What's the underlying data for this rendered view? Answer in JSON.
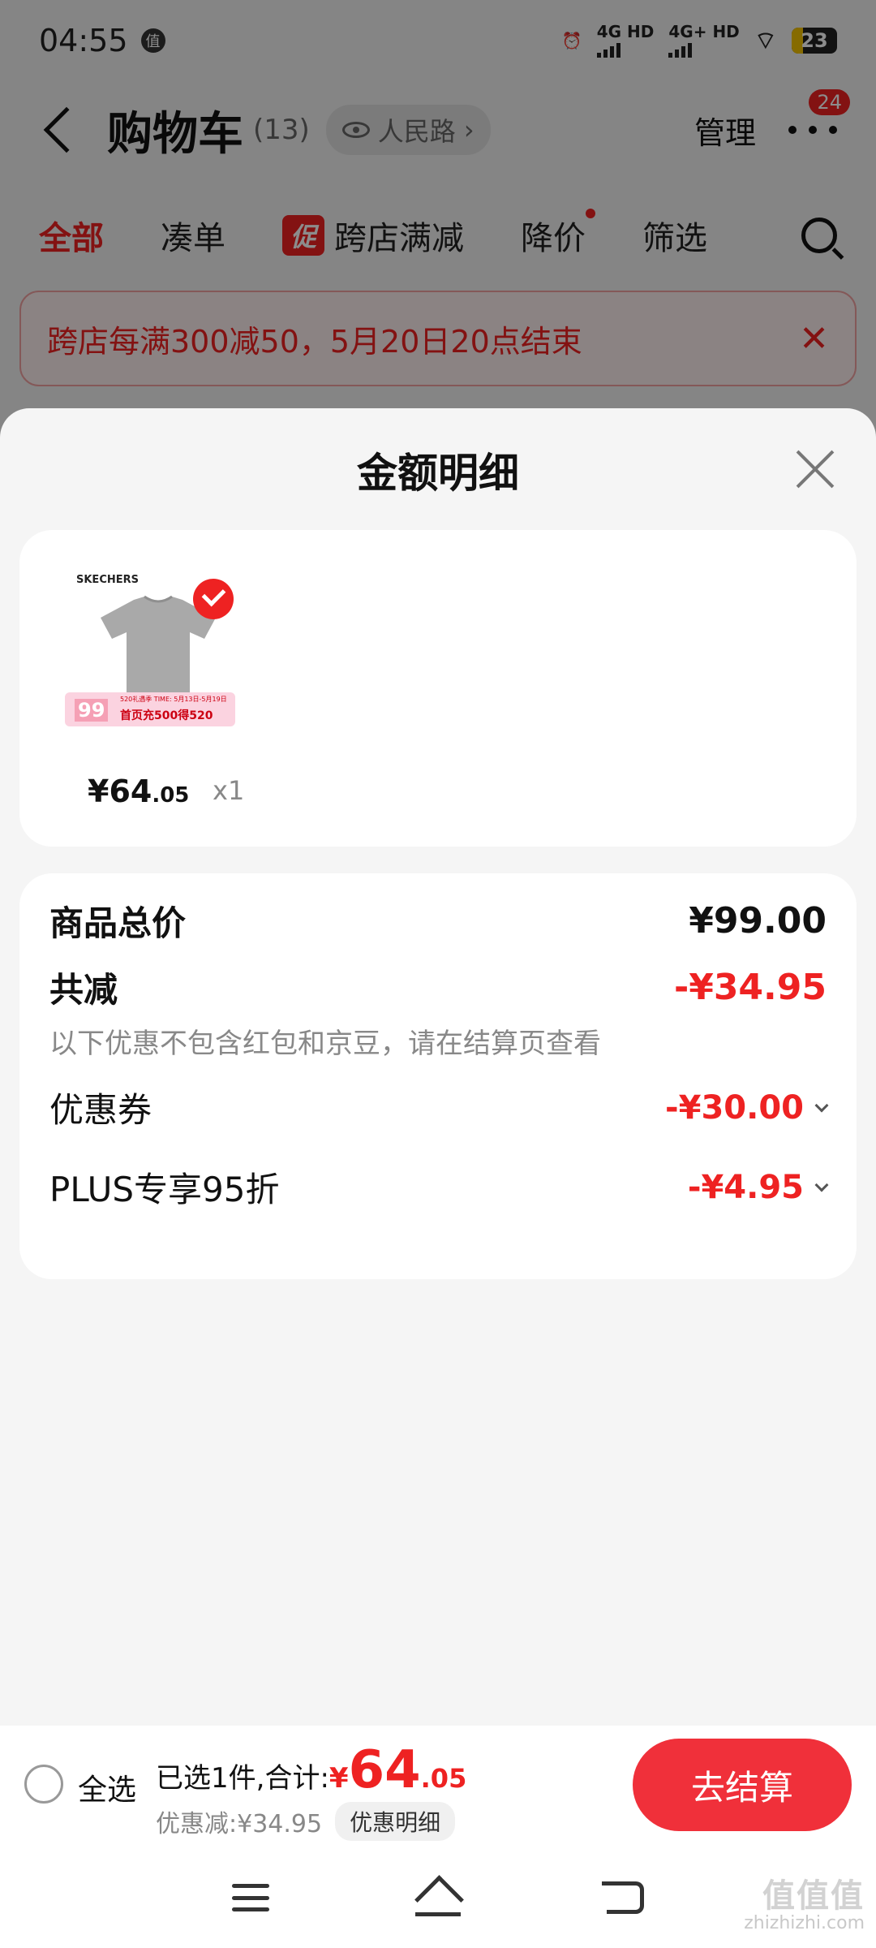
{
  "status_bar": {
    "time": "04:55",
    "app_icon": "值",
    "network1": "4G HD",
    "network2": "4G+ HD",
    "battery": "23"
  },
  "nav": {
    "title": "购物车",
    "count": "(13)",
    "location": "人民路",
    "location_chevron": "›",
    "manage": "管理",
    "badge": "24"
  },
  "tabs": {
    "all": "全部",
    "combine": "凑单",
    "promo_tag": "促",
    "cross_store": "跨店满减",
    "price_drop": "降价",
    "filter": "筛选"
  },
  "banner": {
    "text": "跨店每满300减50，5月20日20点结束",
    "close": "✕"
  },
  "sheet": {
    "title": "金额明细",
    "product": {
      "brand": "SKECHERS",
      "promo_number": "99",
      "promo_small": "520礼遇季  TIME: 5月13日-5月19日",
      "promo_text": "首页充500得520",
      "price_main": "¥64",
      "price_decimal": ".05",
      "qty": "x1"
    },
    "summary": {
      "total_label": "商品总价",
      "total_value": "¥99.00",
      "reduce_label": "共减",
      "reduce_value": "-¥34.95",
      "note": "以下优惠不包含红包和京豆，请在结算页查看",
      "coupon_label": "优惠券",
      "coupon_value": "-¥30.00",
      "plus_label": "PLUS专享95折",
      "plus_value": "-¥4.95"
    }
  },
  "checkout": {
    "select_all": "全选",
    "selected_prefix": "已选1件,合计:",
    "yen": "¥",
    "total_int": "64",
    "total_dec": ".05",
    "discount": "优惠减:¥34.95",
    "detail": "优惠明细",
    "pay": "去结算"
  },
  "watermark": {
    "brand": "值值值",
    "site": "zhizhizhi.com"
  },
  "colors": {
    "accent": "#e22222",
    "pay_button": "#f0303a"
  }
}
